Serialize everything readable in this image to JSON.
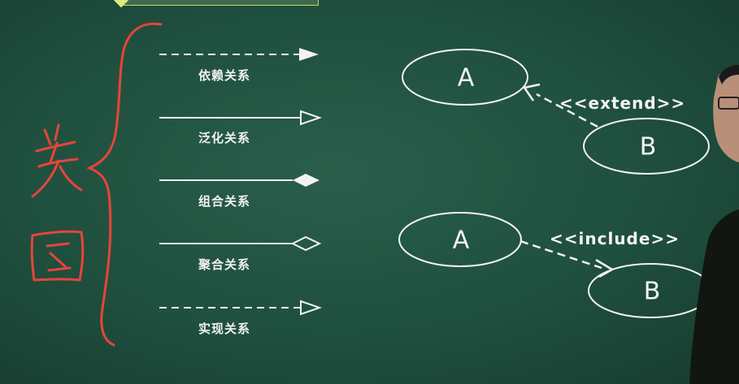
{
  "relations": [
    {
      "label": "依赖关系"
    },
    {
      "label": "泛化关系"
    },
    {
      "label": "组合关系"
    },
    {
      "label": "聚合关系"
    },
    {
      "label": "实现关系"
    }
  ],
  "extend_example": {
    "base": "A",
    "extension": "B",
    "stereotype": "<<extend>>"
  },
  "include_example": {
    "base": "A",
    "included": "B",
    "stereotype": "<<include>>"
  },
  "colors": {
    "board": "#1f4f3e",
    "chalk": "#f2f2f2",
    "red_marker": "#e8443a"
  }
}
